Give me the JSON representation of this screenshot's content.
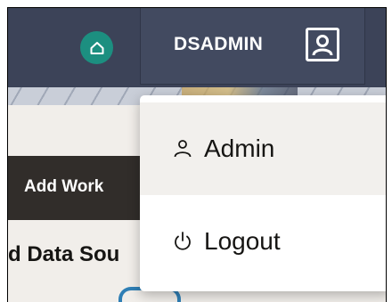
{
  "header": {
    "home_icon": "home-icon",
    "user": {
      "name": "DSADMIN",
      "icon": "user-profile-icon"
    }
  },
  "background": {
    "toolbar_button_label": "Add Work",
    "section_title": "d Data Sou"
  },
  "user_menu": {
    "items": [
      {
        "label": "Admin",
        "icon": "person-icon"
      },
      {
        "label": "Logout",
        "icon": "power-icon"
      }
    ]
  },
  "colors": {
    "topbar": "#3c4358",
    "home_accent": "#1c8f80",
    "workbar": "#312d2a",
    "content_bg": "#f1eeea",
    "menu_hover": "#f2f0ed"
  }
}
